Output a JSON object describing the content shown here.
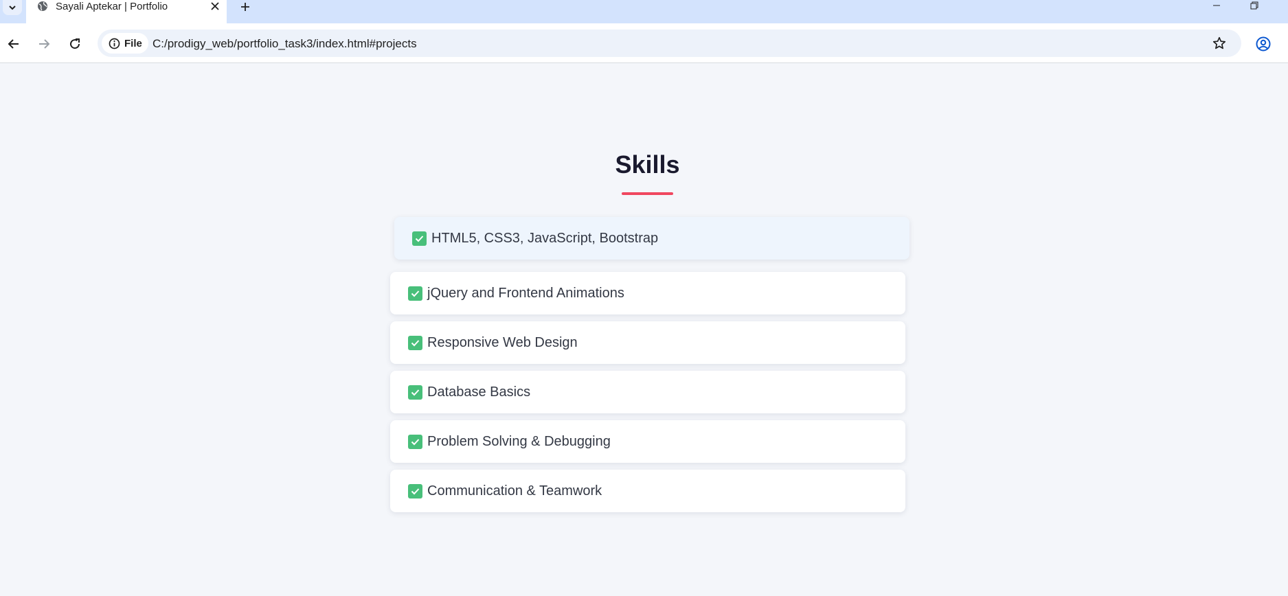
{
  "browser": {
    "tab_title": "Sayali Aptekar | Portfolio",
    "site_chip_label": "File",
    "url": "C:/prodigy_web/portfolio_task3/index.html#projects",
    "icons": {
      "tab_search": "chevron-down-icon",
      "favicon": "globe-icon",
      "tab_close": "close-icon",
      "new_tab": "plus-icon",
      "minimize": "minimize-icon",
      "restore": "restore-icon",
      "back": "arrow-left-icon",
      "forward": "arrow-right-icon",
      "reload": "reload-icon",
      "site_info": "info-icon",
      "bookmark": "star-icon",
      "profile": "profile-icon"
    }
  },
  "skills_section": {
    "title": "Skills",
    "accent_color": "#f0475f",
    "check_color": "#48bf7a",
    "items": [
      {
        "label": "HTML5, CSS3, JavaScript, Bootstrap"
      },
      {
        "label": "jQuery and Frontend Animations"
      },
      {
        "label": "Responsive Web Design"
      },
      {
        "label": "Database Basics"
      },
      {
        "label": "Problem Solving & Debugging"
      },
      {
        "label": "Communication & Teamwork"
      }
    ]
  }
}
